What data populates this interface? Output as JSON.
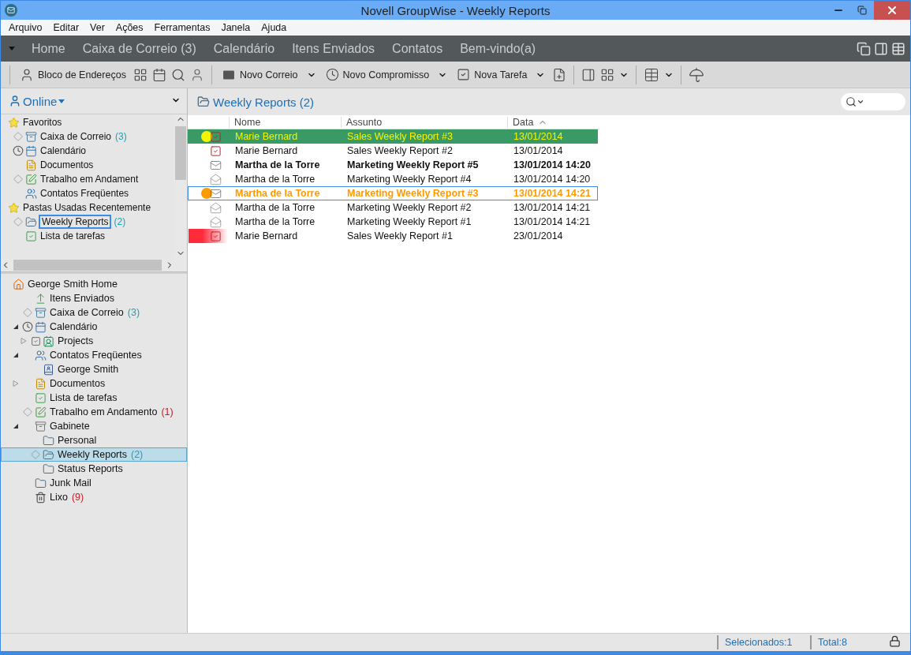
{
  "window": {
    "title": "Novell GroupWise - Weekly Reports"
  },
  "menu": [
    "Arquivo",
    "Editar",
    "Ver",
    "Ações",
    "Ferramentas",
    "Janela",
    "Ajuda"
  ],
  "nav_tabs": [
    "Home",
    "Caixa de Correio (3)",
    "Calendário",
    "Itens Enviados",
    "Contatos",
    "Bem-vindo(a)"
  ],
  "toolbar": [
    {
      "kind": "address",
      "label": "Bloco de Endereços",
      "dropdown": false
    },
    {
      "kind": "mail",
      "label": "Novo Correio",
      "dropdown": true
    },
    {
      "kind": "appointment",
      "label": "Novo Compromisso",
      "dropdown": true
    },
    {
      "kind": "task",
      "label": "Nova Tarefa",
      "dropdown": true
    }
  ],
  "sidebar": {
    "mode": "Online",
    "favorites": [
      {
        "kind": "star",
        "label": "Favoritos",
        "tagged": false,
        "selected": false,
        "children": [
          {
            "kind": "mailbox",
            "label": "Caixa de Correio",
            "count": "(3)",
            "color": "#1aa3b8",
            "tagged": true,
            "selected": false
          },
          {
            "kind": "calendar",
            "label": "Calendário",
            "tagged": false,
            "selected": false
          },
          {
            "kind": "documents",
            "label": "Documentos",
            "tagged": false,
            "selected": false
          },
          {
            "kind": "work",
            "label": "Trabalho em Andament",
            "tagged": true,
            "selected": false
          },
          {
            "kind": "contacts",
            "label": "Contatos Freqüentes",
            "tagged": false,
            "selected": false
          }
        ]
      },
      {
        "kind": "star",
        "label": "Pastas Usadas Recentemente",
        "tagged": false,
        "selected": false,
        "children": [
          {
            "kind": "folder-open",
            "label": "Weekly Reports",
            "count": "(2)",
            "color": "#1aa3b8",
            "tagged": true,
            "selected": true
          },
          {
            "kind": "tasks",
            "label": "Lista de tarefas",
            "tagged": false,
            "selected": false
          }
        ]
      }
    ],
    "tree": [
      {
        "kind": "home",
        "label": "George Smith Home",
        "tagged": false,
        "selected": false,
        "children": [
          {
            "kind": "sent",
            "label": "Itens Enviados",
            "tagged": false,
            "selected": false
          },
          {
            "kind": "mailbox",
            "label": "Caixa de Correio",
            "count": "(3)",
            "color": "#1aa3b8",
            "tagged": true,
            "selected": false
          },
          {
            "kind": "calendar",
            "label": "Calendário",
            "tagged": false,
            "selected": false,
            "expanded": true,
            "children": [
              {
                "kind": "project",
                "label": "Projects",
                "tagged": false,
                "selected": false,
                "expanded": false,
                "checked": true
              }
            ]
          },
          {
            "kind": "contacts",
            "label": "Contatos Freqüentes",
            "tagged": false,
            "selected": false,
            "expanded": true,
            "children": [
              {
                "kind": "addressbook",
                "label": "George Smith",
                "tagged": false,
                "selected": false
              }
            ]
          },
          {
            "kind": "documents",
            "label": "Documentos",
            "tagged": false,
            "selected": false,
            "expanded": false
          },
          {
            "kind": "tasks",
            "label": "Lista de tarefas",
            "tagged": false,
            "selected": false
          },
          {
            "kind": "work",
            "label": "Trabalho em Andamento",
            "count": "(1)",
            "color": "#c0202a",
            "tagged": true,
            "selected": false
          },
          {
            "kind": "cabinet",
            "label": "Gabinete",
            "tagged": false,
            "selected": false,
            "expanded": true,
            "children": [
              {
                "kind": "folder",
                "label": "Personal",
                "tagged": false,
                "selected": false
              },
              {
                "kind": "folder-open",
                "label": "Weekly Reports",
                "count": "(2)",
                "color": "#1aa3b8",
                "tagged": true,
                "selected": true
              },
              {
                "kind": "folder",
                "label": "Status Reports",
                "tagged": false,
                "selected": false
              }
            ]
          },
          {
            "kind": "folder",
            "label": "Junk Mail",
            "tagged": false,
            "selected": false
          },
          {
            "kind": "trash",
            "label": "Lixo",
            "count": "(9)",
            "color": "#c0202a",
            "tagged": false,
            "selected": false
          }
        ]
      }
    ]
  },
  "folder": {
    "title": "Weekly Reports (2)"
  },
  "table": {
    "columns": [
      "Nome",
      "Assunto",
      "Data"
    ],
    "rows": [
      {
        "kind": "task",
        "name": "Marie Bernard",
        "subject": "Sales Weekly Report #3",
        "date": "13/01/2014",
        "unread": false,
        "highlighted": true,
        "selected": false,
        "color": "#f5f500"
      },
      {
        "kind": "task",
        "name": "Marie Bernard",
        "subject": "Sales Weekly Report #2",
        "date": "13/01/2014",
        "unread": false,
        "highlighted": false,
        "selected": false
      },
      {
        "kind": "mail",
        "name": "Martha de la Torre",
        "subject": "Marketing Weekly Report #5",
        "date": "13/01/2014 14:20",
        "unread": true,
        "highlighted": false,
        "selected": false
      },
      {
        "kind": "opened",
        "name": "Martha de la Torre",
        "subject": "Marketing Weekly Report #4",
        "date": "13/01/2014 14:20",
        "unread": false,
        "highlighted": false,
        "selected": false
      },
      {
        "kind": "mail",
        "name": "Martha de la Torre",
        "subject": "Marketing Weekly Report #3",
        "date": "13/01/2014 14:21",
        "unread": true,
        "highlighted": false,
        "selected": true,
        "color": "#ff9a00"
      },
      {
        "kind": "opened",
        "name": "Martha de la Torre",
        "subject": "Marketing Weekly Report #2",
        "date": "13/01/2014 14:21",
        "unread": false,
        "highlighted": false,
        "selected": false
      },
      {
        "kind": "opened",
        "name": "Martha de la Torre",
        "subject": "Marketing Weekly Report #1",
        "date": "13/01/2014 14:21",
        "unread": false,
        "highlighted": false,
        "selected": false
      },
      {
        "kind": "task",
        "name": "Marie Bernard",
        "subject": "Sales Weekly Report #1",
        "date": "23/01/2014",
        "unread": false,
        "highlighted": false,
        "selected": false,
        "color": "#ff2a3a"
      }
    ]
  },
  "status_bar": [
    "Selecionados:1",
    "Total:8"
  ]
}
